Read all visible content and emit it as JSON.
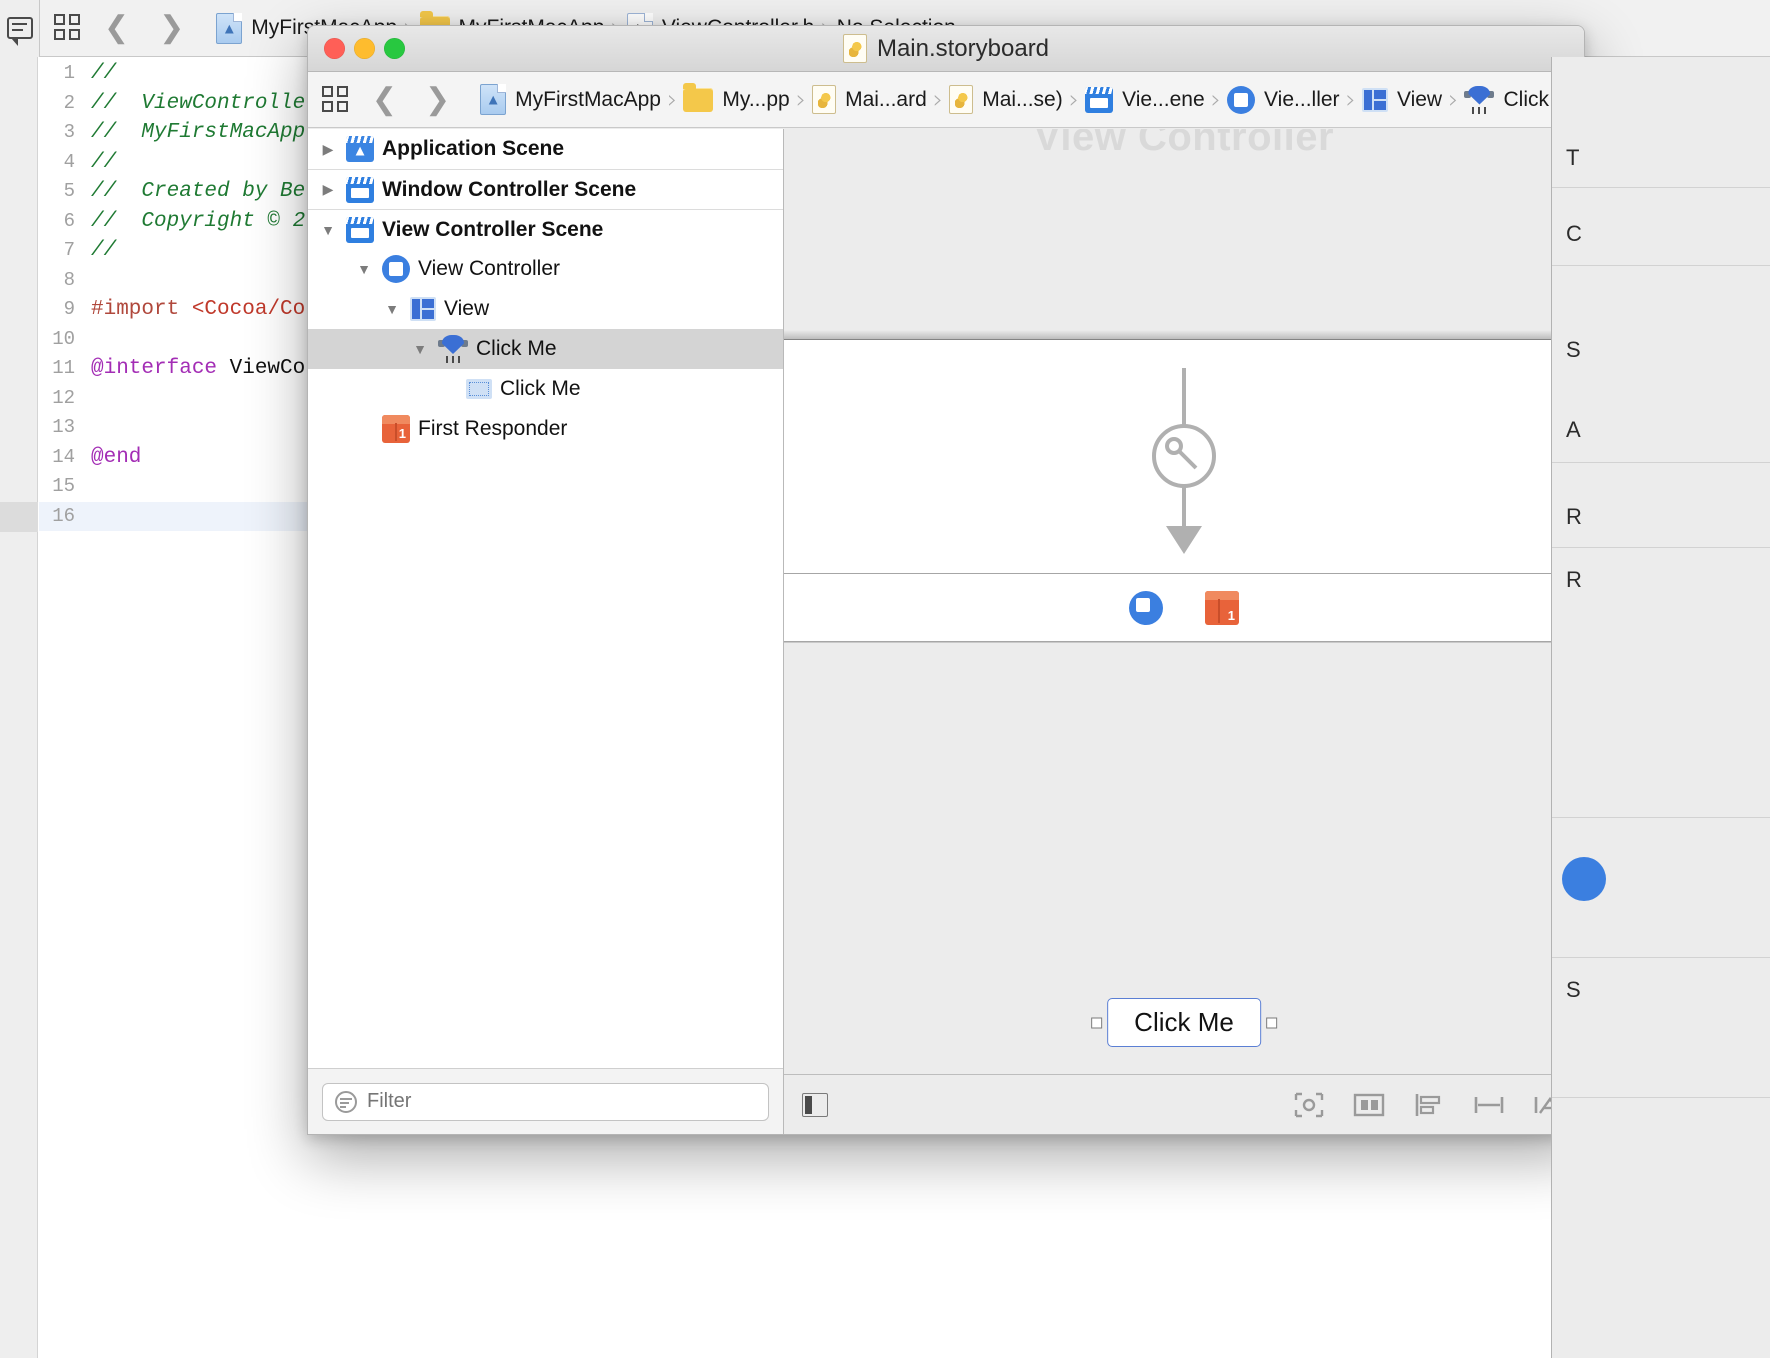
{
  "app": {
    "main_window_title": "MyFirstMacApp",
    "float_window_title": "Main.storyboard"
  },
  "main_jumpbar": {
    "related_items_icon": "related-items-icon",
    "back_icon": "chevron-left-icon",
    "forward_icon": "chevron-right-icon",
    "file_icon": "app-file-icon",
    "items": [
      {
        "label": "MyFirstMacApp",
        "icon": "app-file-icon"
      },
      {
        "label": "MyFirstMacApp",
        "icon": "folder-icon"
      },
      {
        "label": "ViewController.h",
        "icon": "header-file-icon"
      },
      {
        "label": "No Selection",
        "icon": "none"
      }
    ],
    "separator": "›"
  },
  "editor": {
    "current_line": 16,
    "lines": [
      {
        "n": 1,
        "segments": [
          {
            "t": "//",
            "c": "comment"
          }
        ]
      },
      {
        "n": 2,
        "segments": [
          {
            "t": "//  ViewController.h",
            "c": "comment"
          }
        ]
      },
      {
        "n": 3,
        "segments": [
          {
            "t": "//  MyFirstMacApp",
            "c": "comment"
          }
        ]
      },
      {
        "n": 4,
        "segments": [
          {
            "t": "//",
            "c": "comment"
          }
        ]
      },
      {
        "n": 5,
        "segments": [
          {
            "t": "//  Created by Be",
            "c": "comment"
          }
        ]
      },
      {
        "n": 6,
        "segments": [
          {
            "t": "//  Copyright © 2",
            "c": "comment"
          }
        ]
      },
      {
        "n": 7,
        "segments": [
          {
            "t": "//",
            "c": "comment"
          }
        ]
      },
      {
        "n": 8,
        "segments": [
          {
            "t": "",
            "c": "plain"
          }
        ]
      },
      {
        "n": 9,
        "segments": [
          {
            "t": "#import ",
            "c": "pre"
          },
          {
            "t": "<Cocoa/Co",
            "c": "str"
          }
        ]
      },
      {
        "n": 10,
        "segments": [
          {
            "t": "",
            "c": "plain"
          }
        ]
      },
      {
        "n": 11,
        "segments": [
          {
            "t": "@interface ",
            "c": "key"
          },
          {
            "t": "ViewCo",
            "c": "plain"
          }
        ]
      },
      {
        "n": 12,
        "segments": [
          {
            "t": "",
            "c": "plain"
          }
        ]
      },
      {
        "n": 13,
        "segments": [
          {
            "t": "",
            "c": "plain"
          }
        ]
      },
      {
        "n": 14,
        "segments": [
          {
            "t": "@end",
            "c": "key"
          }
        ]
      },
      {
        "n": 15,
        "segments": [
          {
            "t": "",
            "c": "plain"
          }
        ]
      },
      {
        "n": 16,
        "segments": [
          {
            "t": "",
            "c": "plain"
          }
        ]
      }
    ]
  },
  "float_window": {
    "traffic_lights": {
      "close": "close-button",
      "minimize": "minimize-button",
      "zoom": "zoom-button"
    },
    "title": "Main.storyboard",
    "title_icon": "storyboard-file-icon",
    "jumpbar": {
      "related_items_icon": "related-items-icon",
      "back_icon": "chevron-left-icon",
      "forward_icon": "chevron-right-icon",
      "separator": "›",
      "items": [
        {
          "label": "MyFirstMacApp",
          "icon": "app-file-icon"
        },
        {
          "label": "My...pp",
          "icon": "folder-icon"
        },
        {
          "label": "Mai...ard",
          "icon": "storyboard-file-icon"
        },
        {
          "label": "Mai...se)",
          "icon": "storyboard-file-icon"
        },
        {
          "label": "Vie...ene",
          "icon": "scene-icon"
        },
        {
          "label": "Vie...ller",
          "icon": "view-controller-icon"
        },
        {
          "label": "View",
          "icon": "view-icon"
        },
        {
          "label": "Click Me",
          "icon": "push-button-icon"
        }
      ]
    }
  },
  "outline": {
    "rows": [
      {
        "label": "Application Scene",
        "icon": "app-scene-icon",
        "indent": 0,
        "twisty": "collapsed",
        "bold": true,
        "selected": false,
        "separator_above": false
      },
      {
        "label": "Window Controller Scene",
        "icon": "scene-icon",
        "indent": 0,
        "twisty": "collapsed",
        "bold": true,
        "selected": false,
        "separator_above": true
      },
      {
        "label": "View Controller Scene",
        "icon": "scene-icon",
        "indent": 0,
        "twisty": "expanded",
        "bold": true,
        "selected": false,
        "separator_above": true
      },
      {
        "label": "View Controller",
        "icon": "view-controller-icon",
        "indent": 1,
        "twisty": "expanded",
        "bold": false,
        "selected": false,
        "separator_above": false
      },
      {
        "label": "View",
        "icon": "view-icon",
        "indent": 2,
        "twisty": "expanded",
        "bold": false,
        "selected": false,
        "separator_above": false
      },
      {
        "label": "Click Me",
        "icon": "push-button-icon",
        "indent": 3,
        "twisty": "expanded",
        "bold": false,
        "selected": true,
        "separator_above": false
      },
      {
        "label": "Click Me",
        "icon": "button-cell-icon",
        "indent": 4,
        "twisty": "none",
        "bold": false,
        "selected": false,
        "separator_above": false
      },
      {
        "label": "First Responder",
        "icon": "first-responder-icon",
        "indent": 1,
        "twisty": "none",
        "bold": false,
        "selected": false,
        "separator_above": false
      }
    ],
    "filter": {
      "placeholder": "Filter",
      "value": "",
      "icon": "filter-icon"
    }
  },
  "canvas": {
    "scene_title": "View Controller",
    "button_label": "Click Me",
    "dock_icons": [
      {
        "name": "view-controller-dock-icon"
      },
      {
        "name": "first-responder-dock-icon"
      }
    ],
    "entry_point_icon": "storyboard-entry-point-icon",
    "bottom_bar": {
      "left_toggle_icon": "document-outline-toggle-icon",
      "right_icons": [
        {
          "name": "update-frames-icon"
        },
        {
          "name": "embed-in-icon"
        },
        {
          "name": "align-icon"
        },
        {
          "name": "pin-icon"
        },
        {
          "name": "resolve-auto-layout-icon"
        }
      ]
    }
  },
  "inspector": {
    "labels": [
      "T",
      "C",
      "S",
      "A",
      "R",
      "R"
    ]
  },
  "colors": {
    "accent_blue": "#3b7fe0",
    "selection_gray": "#d4d4d4",
    "comment_green": "#1f7a33",
    "keyword_purple": "#a32db5",
    "string_red": "#c0392b",
    "traffic_red": "#ff5f57",
    "traffic_yellow": "#febc2e",
    "traffic_green": "#28c840",
    "orange_responder": "#e8633a"
  }
}
